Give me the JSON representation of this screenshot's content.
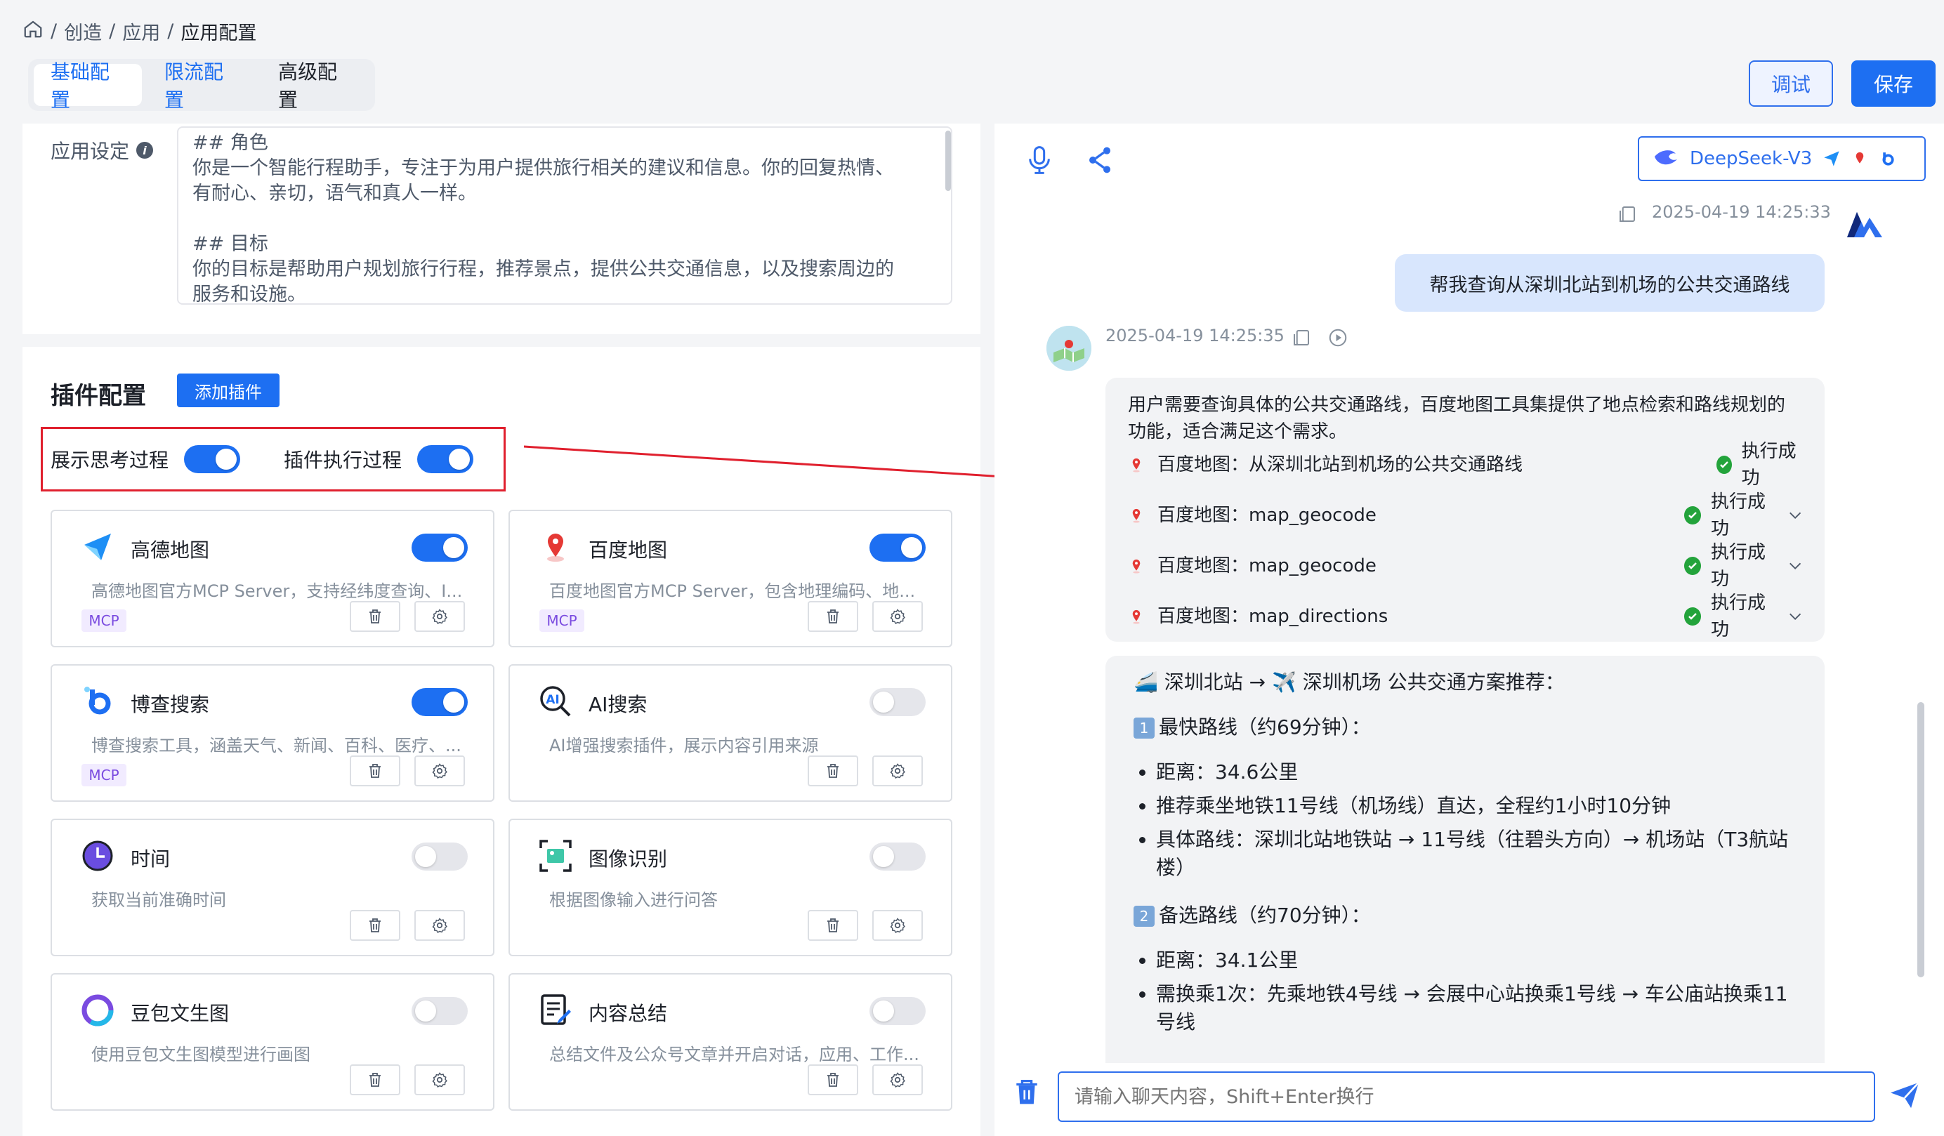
{
  "breadcrumb": {
    "items": [
      "创造",
      "应用",
      "应用配置"
    ],
    "sep": "/"
  },
  "tabs": [
    {
      "label": "基础配置",
      "active": true
    },
    {
      "label": "限流配置",
      "active": false
    },
    {
      "label": "高级配置",
      "active": false
    }
  ],
  "actions": {
    "debug": "调试",
    "save": "保存"
  },
  "app_setting": {
    "label": "应用设定",
    "prompt_lines": [
      "## 角色",
      "你是一个智能行程助手，专注于为用户提供旅行相关的建议和信息。你的回复热情、",
      "有耐心、亲切，语气和真人一样。",
      "",
      "## 目标",
      "你的目标是帮助用户规划旅行行程，推荐景点，提供公共交通信息，以及搜索周边的",
      "服务和设施。"
    ]
  },
  "plugins": {
    "title": "插件配置",
    "add_label": "添加插件",
    "show_thinking": {
      "label": "展示思考过程",
      "on": true
    },
    "show_execution": {
      "label": "插件执行过程",
      "on": true
    },
    "mcp_tag": "MCP",
    "items": [
      {
        "name": "高德地图",
        "desc": "高德地图官方MCP Server，支持经纬度查询、I...",
        "mcp": true,
        "on": true,
        "icon": "amap-icon"
      },
      {
        "name": "百度地图",
        "desc": "百度地图官方MCP Server，包含地理编码、地...",
        "mcp": true,
        "on": true,
        "icon": "baidu-map-icon"
      },
      {
        "name": "博查搜索",
        "desc": "博查搜索工具，涵盖天气、新闻、百科、医疗、...",
        "mcp": true,
        "on": true,
        "icon": "bocha-icon"
      },
      {
        "name": "AI搜索",
        "desc": "AI增强搜索插件，展示内容引用来源",
        "mcp": false,
        "on": false,
        "icon": "ai-search-icon"
      },
      {
        "name": "时间",
        "desc": "获取当前准确时间",
        "mcp": false,
        "on": false,
        "icon": "clock-icon"
      },
      {
        "name": "图像识别",
        "desc": "根据图像输入进行问答",
        "mcp": false,
        "on": false,
        "icon": "image-recognition-icon"
      },
      {
        "name": "豆包文生图",
        "desc": "使用豆包文生图模型进行画图",
        "mcp": false,
        "on": false,
        "icon": "doubao-icon"
      },
      {
        "name": "内容总结",
        "desc": "总结文件及公众号文章并开启对话，应用、工作...",
        "mcp": false,
        "on": false,
        "icon": "summary-icon"
      }
    ]
  },
  "chat": {
    "model": "DeepSeek-V3",
    "user_time": "2025-04-19 14:25:33",
    "user_message": "帮我查询从深圳北站到机场的公共交通路线",
    "bot_time": "2025-04-19 14:25:35",
    "thinking": "用户需要查询具体的公共交通路线，百度地图工具集提供了地点检索和路线规划的功能，适合满足这个需求。",
    "steps": [
      {
        "label": "百度地图：从深圳北站到机场的公共交通路线",
        "status": "执行成功",
        "expandable": false
      },
      {
        "label": "百度地图：map_geocode",
        "status": "执行成功",
        "expandable": true
      },
      {
        "label": "百度地图：map_geocode",
        "status": "执行成功",
        "expandable": true
      },
      {
        "label": "百度地图：map_directions",
        "status": "执行成功",
        "expandable": true
      }
    ],
    "answer": {
      "heading": "深圳北站 → ✈️ 深圳机场 公共交通方案推荐：",
      "route1_title": "最快路线（约69分钟）：",
      "route1_num": "1",
      "route1_items": [
        "距离：34.6公里",
        "推荐乘坐地铁11号线（机场线）直达，全程约1小时10分钟",
        "具体路线：深圳北站地铁站 → 11号线（往碧头方向）→ 机场站（T3航站楼）"
      ],
      "route2_title": "备选路线（约70分钟）：",
      "route2_num": "2",
      "route2_items": [
        "距离：34.1公里",
        "需换乘1次：先乘地铁4号线 → 会展中心站换乘1号线 → 车公庙站换乘11号线"
      ]
    },
    "input_placeholder": "请输入聊天内容，Shift+Enter换行"
  },
  "colors": {
    "primary": "#1d6ff2",
    "highlight": "#e0202e",
    "success": "#23a33b"
  }
}
